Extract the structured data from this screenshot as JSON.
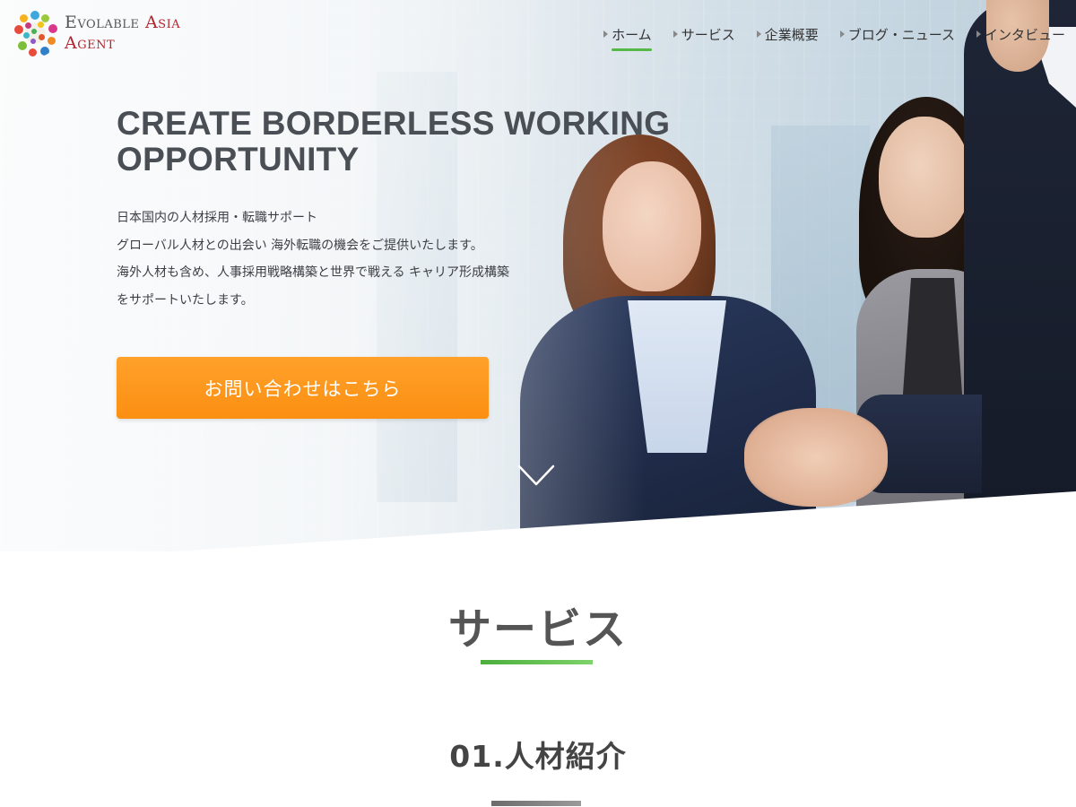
{
  "brand": {
    "logo_line1_a": "Evolable",
    "logo_line1_b": "Asia",
    "logo_line2": "Agent",
    "accent_red": "#b3262f"
  },
  "nav": {
    "items": [
      {
        "label": "ホーム",
        "active": true
      },
      {
        "label": "サービス",
        "active": false
      },
      {
        "label": "企業概要",
        "active": false
      },
      {
        "label": "ブログ・ニュース",
        "active": false
      },
      {
        "label": "インタビュー",
        "active": false
      }
    ],
    "active_color": "#56b847"
  },
  "hero": {
    "title": "CREATE BORDERLESS WORKING OPPORTUNITY",
    "description": [
      "日本国内の人材採用・転職サポート",
      "グローバル人材との出会い 海外転職の機会をご提供いたします。",
      "海外人材も含め、人事採用戦略構築と世界で戦える キャリア形成構築",
      "をサポートいたします。"
    ],
    "cta_label": "お問い合わせはこちら",
    "cta_color": "#fb8f12",
    "scroll_icon": "chevron-down-icon"
  },
  "services": {
    "section_title": "サービス",
    "item_title": "01.人材紹介",
    "underline_color": "#56b847"
  }
}
